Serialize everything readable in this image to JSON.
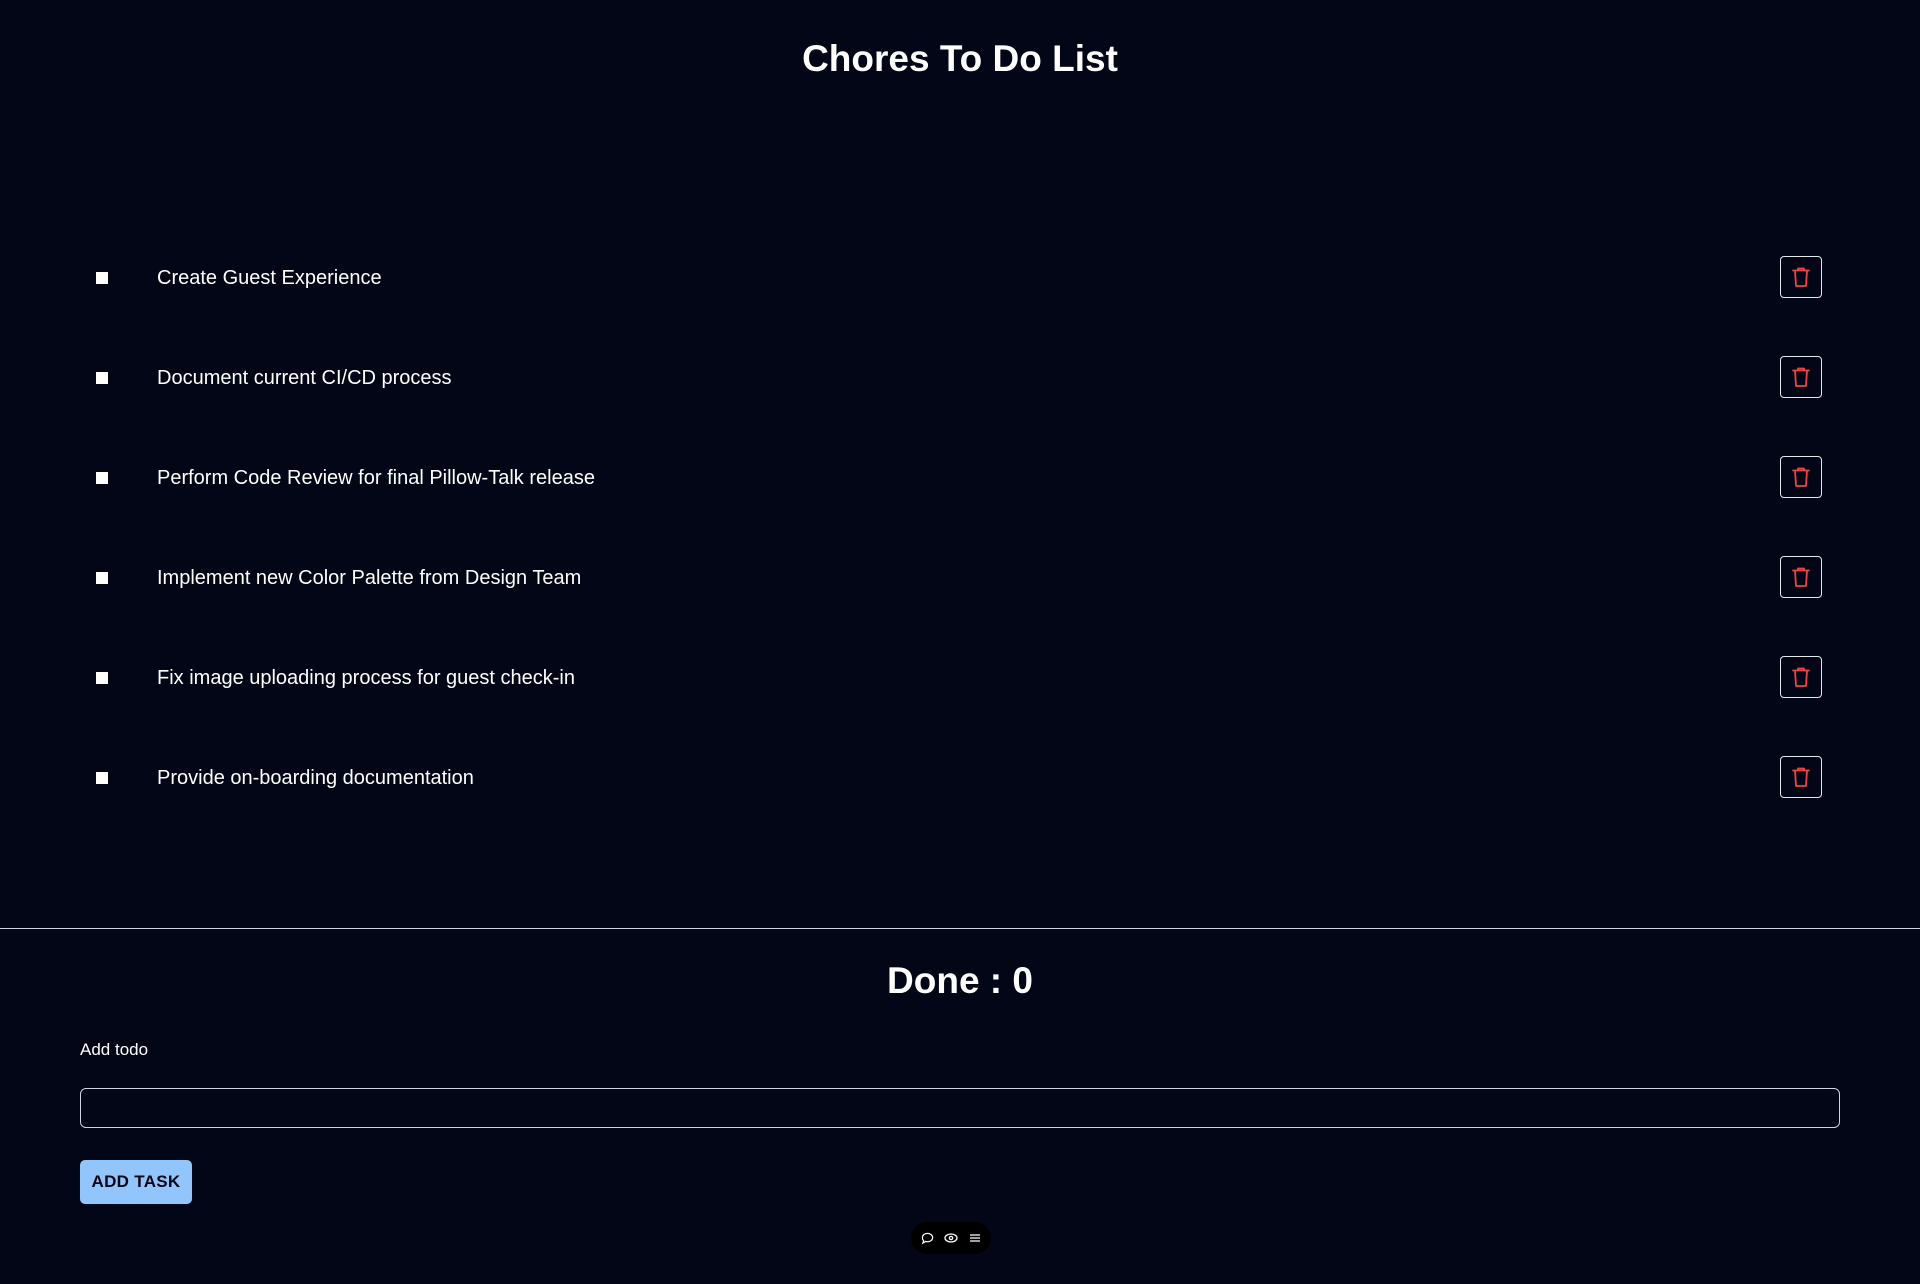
{
  "header": {
    "title": "Chores To Do List"
  },
  "todos": [
    {
      "text": "Create Guest Experience",
      "checked": false
    },
    {
      "text": "Document current CI/CD process",
      "checked": false
    },
    {
      "text": "Perform Code Review for final Pillow-Talk release",
      "checked": false
    },
    {
      "text": "Implement new Color Palette from Design Team",
      "checked": false
    },
    {
      "text": "Fix image uploading process for guest check-in",
      "checked": false
    },
    {
      "text": "Provide on-boarding documentation",
      "checked": false
    }
  ],
  "summary": {
    "done_label": "Done : 0"
  },
  "add_form": {
    "label": "Add todo",
    "input_value": "",
    "input_placeholder": "",
    "button_label": "ADD TASK"
  },
  "toolbar": {
    "icons": [
      "comment-icon",
      "eye-icon",
      "menu-icon"
    ]
  },
  "colors": {
    "background": "#020617",
    "delete_icon": "#ef4444",
    "button": "#93c5fd"
  }
}
